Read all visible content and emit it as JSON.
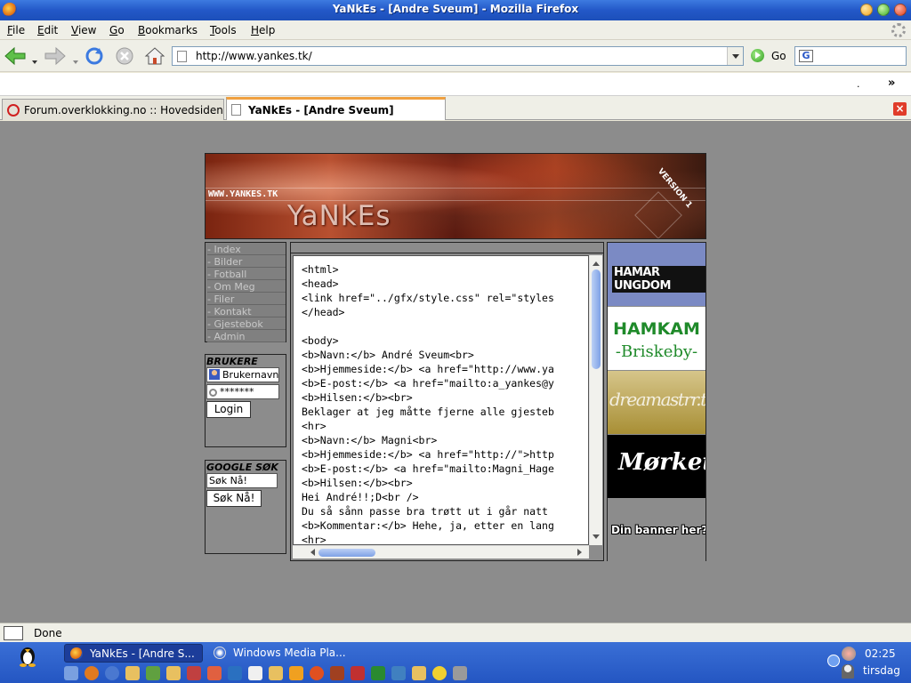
{
  "window": {
    "title": "YaNkEs - [Andre Sveum] - Mozilla Firefox"
  },
  "menubar": [
    "File",
    "Edit",
    "View",
    "Go",
    "Bookmarks",
    "Tools",
    "Help"
  ],
  "navbar": {
    "url": "http://www.yankes.tk/",
    "go_label": "Go",
    "search_engine_icon": "G"
  },
  "bookmarks": {
    "overflow": "»",
    "dot": "."
  },
  "tabs": [
    {
      "label": "Forum.overklokking.no :: Hovedsiden",
      "active": false
    },
    {
      "label": "YaNkEs - [Andre Sveum]",
      "active": true
    }
  ],
  "page": {
    "banner": {
      "url": "WWW.YANKES.TK",
      "logo": "YaNkEs",
      "version": "VERSION 1"
    },
    "nav": [
      "- Index",
      "- Bilder",
      "- Fotball",
      "- Om Meg",
      "- Filer",
      "- Kontakt",
      "- Gjestebok",
      "- Admin"
    ],
    "login": {
      "title": "BRUKERE",
      "username": "Brukernavn",
      "password": "*******",
      "button": "Login"
    },
    "google": {
      "title": "GOOGLE SØK",
      "query": "Søk Nå!",
      "button": "Søk Nå!"
    },
    "code_lines": [
      "<html>",
      "<head>",
      "<link href=\"../gfx/style.css\" rel=\"styles",
      "</head>",
      "",
      "<body>",
      "<b>Navn:</b> André Sveum<br>",
      "<b>Hjemmeside:</b> <a href=\"http://www.ya",
      "<b>E-post:</b> <a href=\"mailto:a_yankes@y",
      "<b>Hilsen:</b><br>",
      "Beklager at jeg måtte fjerne alle gjesteb",
      "<hr>",
      "<b>Navn:</b> Magni<br>",
      "<b>Hjemmeside:</b> <a href=\"http://\">http",
      "<b>E-post:</b> <a href=\"mailto:Magni_Hage",
      "<b>Hilsen:</b><br>",
      "Hei André!!;D<br />",
      "Du så sånn passe bra trøtt ut i går natt",
      "<b>Kommentar:</b> Hehe, ja, etter en lang",
      "<hr>"
    ],
    "ads": {
      "hamar": "HAMAR UNGDOM",
      "hamkam_1": "HAMKAM",
      "hamkam_2": "-Briskeby-",
      "dream": "dreamastrr.tk",
      "morketid": "Mørketid",
      "yours": "Din banner her?"
    }
  },
  "status": {
    "text": "Done"
  },
  "taskbar": {
    "tasks": [
      "YaNkEs - [Andre S...",
      "Windows Media Pla..."
    ],
    "clock": "02:25",
    "day": "tirsdag"
  },
  "colors": {
    "page_bg": "#8c8c8c",
    "titlebar": "#2358c8",
    "taskbar": "#2456c2"
  }
}
